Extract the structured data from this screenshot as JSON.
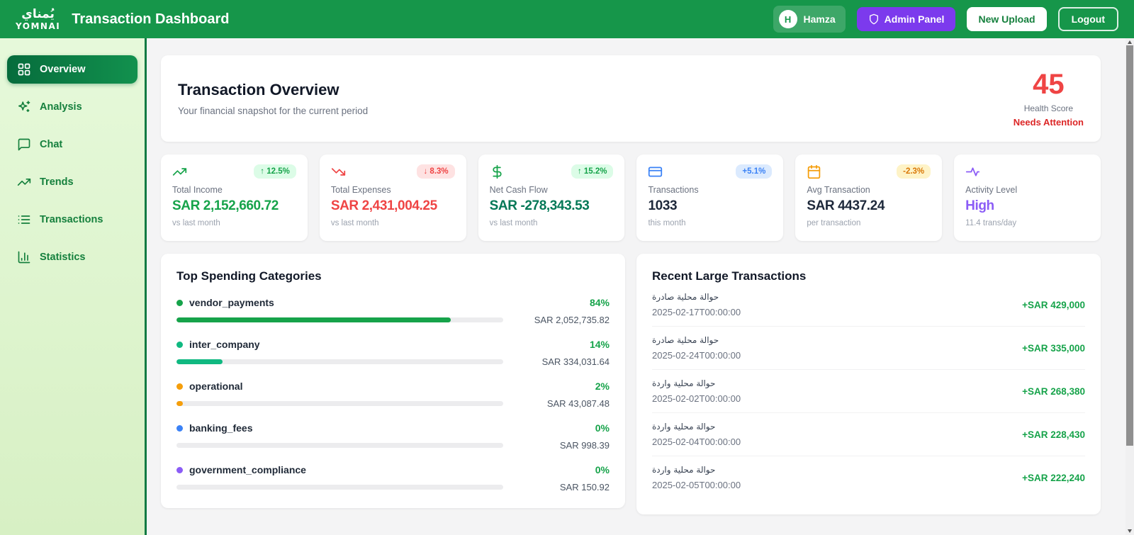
{
  "theme": {
    "header_green": "#16964a",
    "accent_green": "#16a34a",
    "danger_red": "#ef4444",
    "purple": "#7c3aed"
  },
  "header": {
    "logo_arabic": "يُمناي",
    "logo_latin": "YOMNAI",
    "title": "Transaction Dashboard",
    "user": {
      "initial": "H",
      "name": "Hamza"
    },
    "admin_panel_label": "Admin Panel",
    "new_upload_label": "New Upload",
    "logout_label": "Logout"
  },
  "sidebar": {
    "items": [
      {
        "label": "Overview",
        "icon": "layout-grid-icon",
        "active": true
      },
      {
        "label": "Analysis",
        "icon": "sparkles-icon",
        "active": false
      },
      {
        "label": "Chat",
        "icon": "message-square-icon",
        "active": false
      },
      {
        "label": "Trends",
        "icon": "trending-up-icon",
        "active": false
      },
      {
        "label": "Transactions",
        "icon": "list-icon",
        "active": false
      },
      {
        "label": "Statistics",
        "icon": "bar-chart-icon",
        "active": false
      }
    ]
  },
  "overview": {
    "title": "Transaction Overview",
    "subtitle": "Your financial snapshot for the current period",
    "health_score": {
      "value": "45",
      "label": "Health Score",
      "status": "Needs Attention",
      "value_color": "#ef4444",
      "status_color": "#dc2626"
    }
  },
  "kpis": [
    {
      "icon": "trending-up-icon",
      "icon_color": "#16a34a",
      "badge": {
        "text": "↑ 12.5%",
        "color": "#16a34a",
        "bg": "#dcfce7"
      },
      "label": "Total Income",
      "value": "SAR 2,152,660.72",
      "value_color": "#16a34a",
      "sub": "vs last month"
    },
    {
      "icon": "trending-down-icon",
      "icon_color": "#ef4444",
      "badge": {
        "text": "↓ 8.3%",
        "color": "#ef4444",
        "bg": "#fee2e2"
      },
      "label": "Total Expenses",
      "value": "SAR 2,431,004.25",
      "value_color": "#ef4444",
      "sub": "vs last month"
    },
    {
      "icon": "dollar-sign-icon",
      "icon_color": "#16a34a",
      "badge": {
        "text": "↑ 15.2%",
        "color": "#16a34a",
        "bg": "#dcfce7"
      },
      "label": "Net Cash Flow",
      "value": "SAR -278,343.53",
      "value_color": "#047857",
      "sub": "vs last month"
    },
    {
      "icon": "credit-card-icon",
      "icon_color": "#3b82f6",
      "badge": {
        "text": "+5.1%",
        "color": "#3b82f6",
        "bg": "#dbeafe"
      },
      "label": "Transactions",
      "value": "1033",
      "value_color": "#1e293b",
      "sub": "this month"
    },
    {
      "icon": "calendar-icon",
      "icon_color": "#f59e0b",
      "badge": {
        "text": "-2.3%",
        "color": "#d97706",
        "bg": "#fef3c7"
      },
      "label": "Avg Transaction",
      "value": "SAR 4437.24",
      "value_color": "#1e293b",
      "sub": "per transaction"
    },
    {
      "icon": "activity-icon",
      "icon_color": "#8b5cf6",
      "label": "Activity Level",
      "value": "High",
      "value_color": "#8b5cf6",
      "sub": "11.4 trans/day"
    }
  ],
  "spending": {
    "title": "Top Spending Categories",
    "categories": [
      {
        "name": "vendor_payments",
        "pct": "84%",
        "pct_value": 84,
        "amount": "SAR 2,052,735.82",
        "color": "#16a34a"
      },
      {
        "name": "inter_company",
        "pct": "14%",
        "pct_value": 14,
        "amount": "SAR 334,031.64",
        "color": "#10b981"
      },
      {
        "name": "operational",
        "pct": "2%",
        "pct_value": 2,
        "amount": "SAR 43,087.48",
        "color": "#f59e0b"
      },
      {
        "name": "banking_fees",
        "pct": "0%",
        "pct_value": 0,
        "amount": "SAR 998.39",
        "color": "#3b82f6"
      },
      {
        "name": "government_compliance",
        "pct": "0%",
        "pct_value": 0,
        "amount": "SAR 150.92",
        "color": "#8b5cf6"
      }
    ]
  },
  "transactions": {
    "title": "Recent Large Transactions",
    "rows": [
      {
        "name": "حوالة محلية صادرة",
        "date": "2025-02-17T00:00:00",
        "amount": "+SAR 429,000"
      },
      {
        "name": "حوالة محلية صادرة",
        "date": "2025-02-24T00:00:00",
        "amount": "+SAR 335,000"
      },
      {
        "name": "حوالة محلية واردة",
        "date": "2025-02-02T00:00:00",
        "amount": "+SAR 268,380"
      },
      {
        "name": "حوالة محلية واردة",
        "date": "2025-02-04T00:00:00",
        "amount": "+SAR 228,430"
      },
      {
        "name": "حوالة محلية واردة",
        "date": "2025-02-05T00:00:00",
        "amount": "+SAR 222,240"
      }
    ]
  }
}
